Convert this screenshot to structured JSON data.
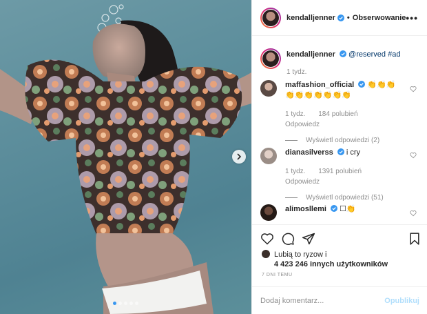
{
  "post": {
    "author": "kendalljenner",
    "follow_label": "Obserwowanie",
    "more_label": "•••"
  },
  "caption": {
    "author": "kendalljenner",
    "mention": "@reserved",
    "hashtag": "#ad",
    "age": "1 tydz."
  },
  "comments": [
    {
      "author": "maffashion_official",
      "text_line1": "👏👏👏",
      "text_line2": "👏👏👏👏👏👏👏",
      "age": "1 tydz.",
      "likes": "184 polubień",
      "reply_label": "Odpowiedz",
      "view_replies": "Wyświetl odpowiedzi (2)"
    },
    {
      "author": "dianasilverss",
      "text_line1": "i cry",
      "age": "1 tydz.",
      "likes": "1391 polubień",
      "reply_label": "Odpowiedz",
      "view_replies": "Wyświetl odpowiedzi (51)"
    },
    {
      "author": "alimosllemi",
      "text_line1": "☐👏"
    }
  ],
  "likes": {
    "line1": "Lubią to ryzow i",
    "line2": "4 423 246 innych użytkowników"
  },
  "timestamp": "7 DNI TEMU",
  "comment_input": {
    "placeholder": "Dodaj komentarz...",
    "publish_label": "Opublikuj"
  },
  "carousel": {
    "slides": 5,
    "active_index": 0
  },
  "colors": {
    "verified": "#3897f0",
    "muted": "#8e8e8e",
    "publish_disabled": "#b2dffc",
    "water": "#5d8e9c"
  }
}
